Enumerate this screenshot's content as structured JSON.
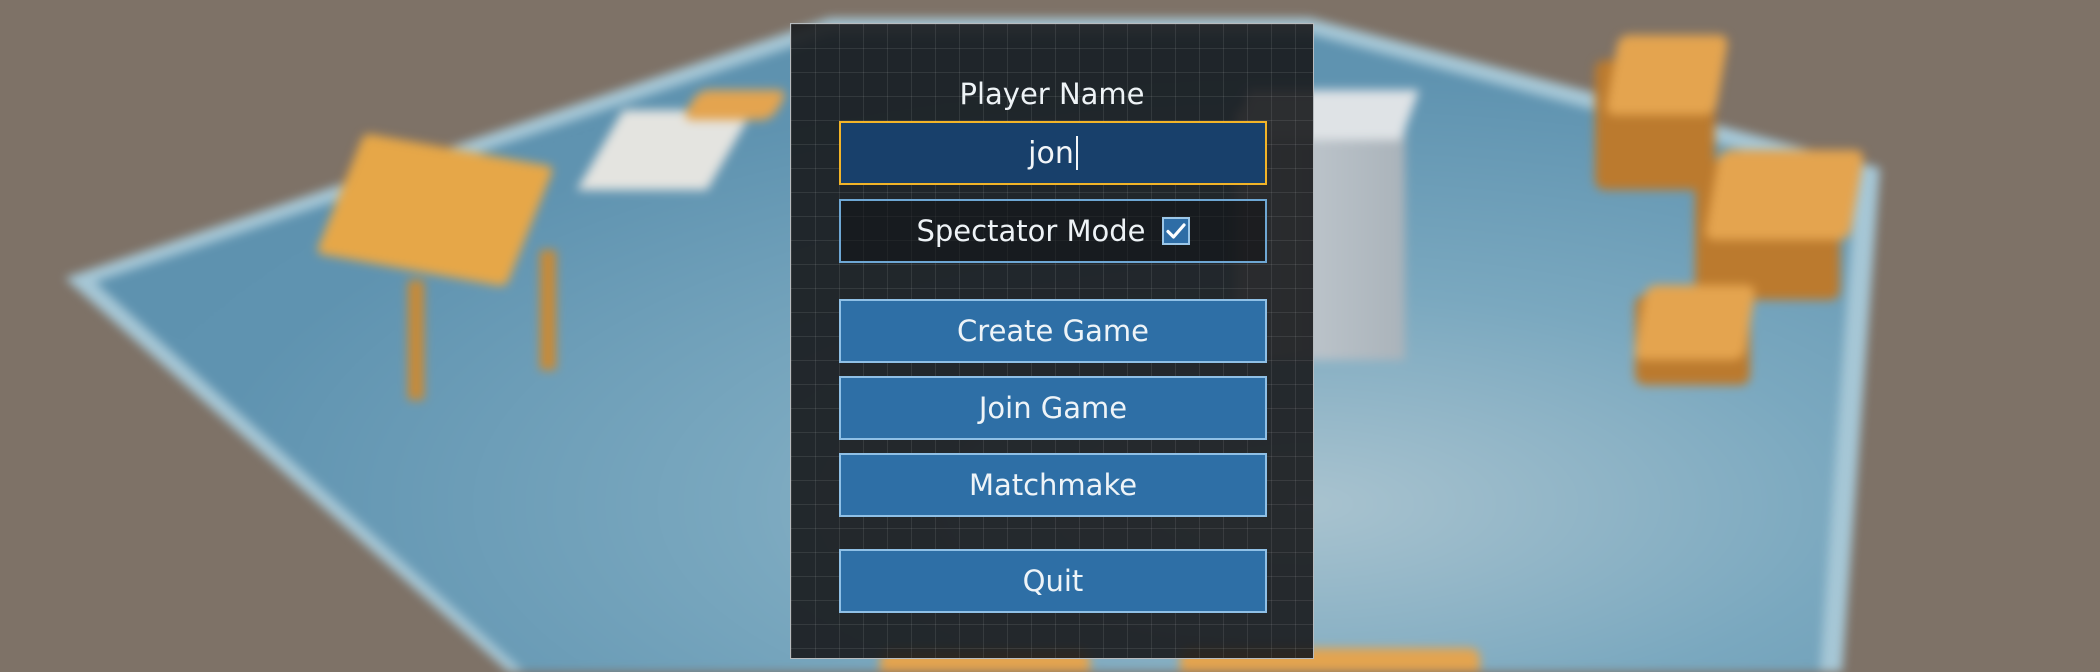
{
  "menu": {
    "player_name_label": "Player Name",
    "player_name_value": "jon",
    "spectator_label": "Spectator Mode",
    "spectator_checked": true,
    "buttons": {
      "create": "Create Game",
      "join": "Join Game",
      "matchmake": "Matchmake",
      "quit": "Quit"
    }
  },
  "colors": {
    "input_border_focus": "#f2b428",
    "button_fill": "#2e6fa6",
    "button_border": "#8fc0e6",
    "panel_bg": "#181a1c"
  },
  "icons": {
    "checkbox": "checkmark-icon"
  }
}
